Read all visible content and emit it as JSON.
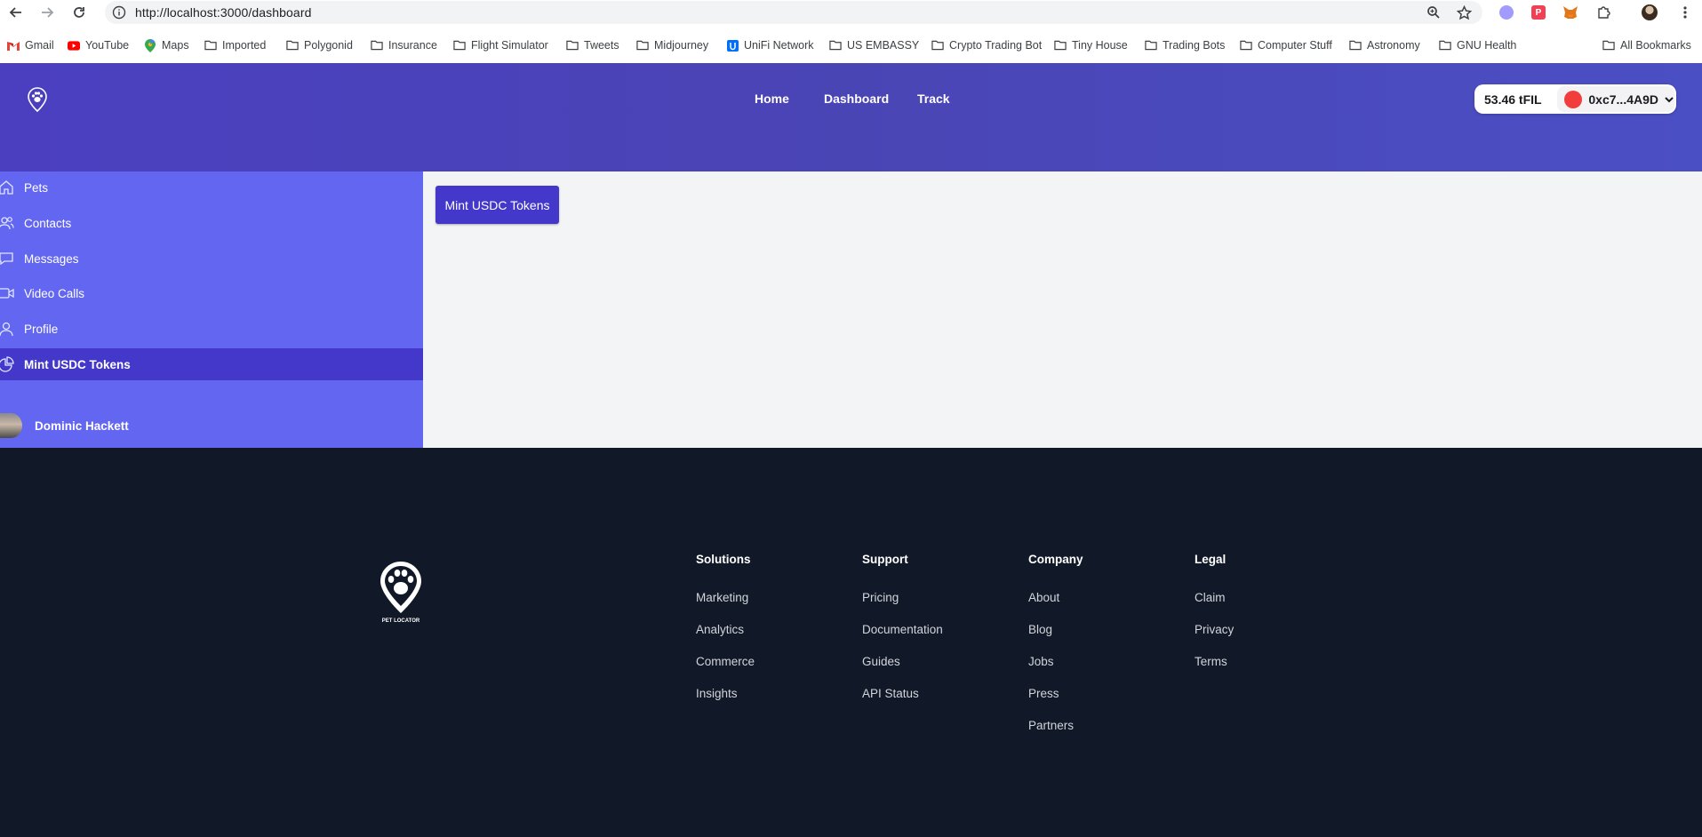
{
  "browser": {
    "url": "http://localhost:3000/dashboard",
    "bookmarks": [
      {
        "label": "Gmail",
        "icon": "gmail-icon"
      },
      {
        "label": "YouTube",
        "icon": "youtube-icon"
      },
      {
        "label": "Maps",
        "icon": "maps-icon"
      },
      {
        "label": "Imported",
        "icon": "folder-icon"
      },
      {
        "label": "Polygonid",
        "icon": "folder-icon"
      },
      {
        "label": "Insurance",
        "icon": "folder-icon"
      },
      {
        "label": "Flight Simulator",
        "icon": "folder-icon"
      },
      {
        "label": "Tweets",
        "icon": "folder-icon"
      },
      {
        "label": "Midjourney",
        "icon": "folder-icon"
      },
      {
        "label": "UniFi Network",
        "icon": "unifi-icon"
      },
      {
        "label": "US EMBASSY",
        "icon": "folder-icon"
      },
      {
        "label": "Crypto Trading Bot",
        "icon": "folder-icon"
      },
      {
        "label": "Tiny House",
        "icon": "folder-icon"
      },
      {
        "label": "Trading Bots",
        "icon": "folder-icon"
      },
      {
        "label": "Computer Stuff",
        "icon": "folder-icon"
      },
      {
        "label": "Astronomy",
        "icon": "folder-icon"
      },
      {
        "label": "GNU Health",
        "icon": "folder-icon"
      }
    ],
    "all_bookmarks": "All Bookmarks"
  },
  "header": {
    "nav": [
      {
        "label": "Home"
      },
      {
        "label": "Dashboard"
      },
      {
        "label": "Track"
      }
    ],
    "wallet": {
      "balance": "53.46 tFIL",
      "address": "0xc7...4A9D"
    }
  },
  "sidebar": {
    "items": [
      {
        "label": "Pets",
        "icon": "home-icon"
      },
      {
        "label": "Contacts",
        "icon": "users-icon"
      },
      {
        "label": "Messages",
        "icon": "chat-icon"
      },
      {
        "label": "Video Calls",
        "icon": "video-icon"
      },
      {
        "label": "Profile",
        "icon": "user-icon"
      },
      {
        "label": "Mint USDC Tokens",
        "icon": "pie-chart-icon",
        "active": true
      }
    ],
    "user_name": "Dominic Hackett"
  },
  "main": {
    "mint_button": "Mint USDC Tokens"
  },
  "footer": {
    "logo_text": "PET LOCATOR",
    "columns": [
      {
        "heading": "Solutions",
        "links": [
          "Marketing",
          "Analytics",
          "Commerce",
          "Insights"
        ]
      },
      {
        "heading": "Support",
        "links": [
          "Pricing",
          "Documentation",
          "Guides",
          "API Status"
        ]
      },
      {
        "heading": "Company",
        "links": [
          "About",
          "Blog",
          "Jobs",
          "Press",
          "Partners"
        ]
      },
      {
        "heading": "Legal",
        "links": [
          "Claim",
          "Privacy",
          "Terms"
        ]
      }
    ]
  },
  "colors": {
    "header": "#4a45b5",
    "sidebar": "#6366f1",
    "active": "#4338ca",
    "footer": "#111827"
  }
}
